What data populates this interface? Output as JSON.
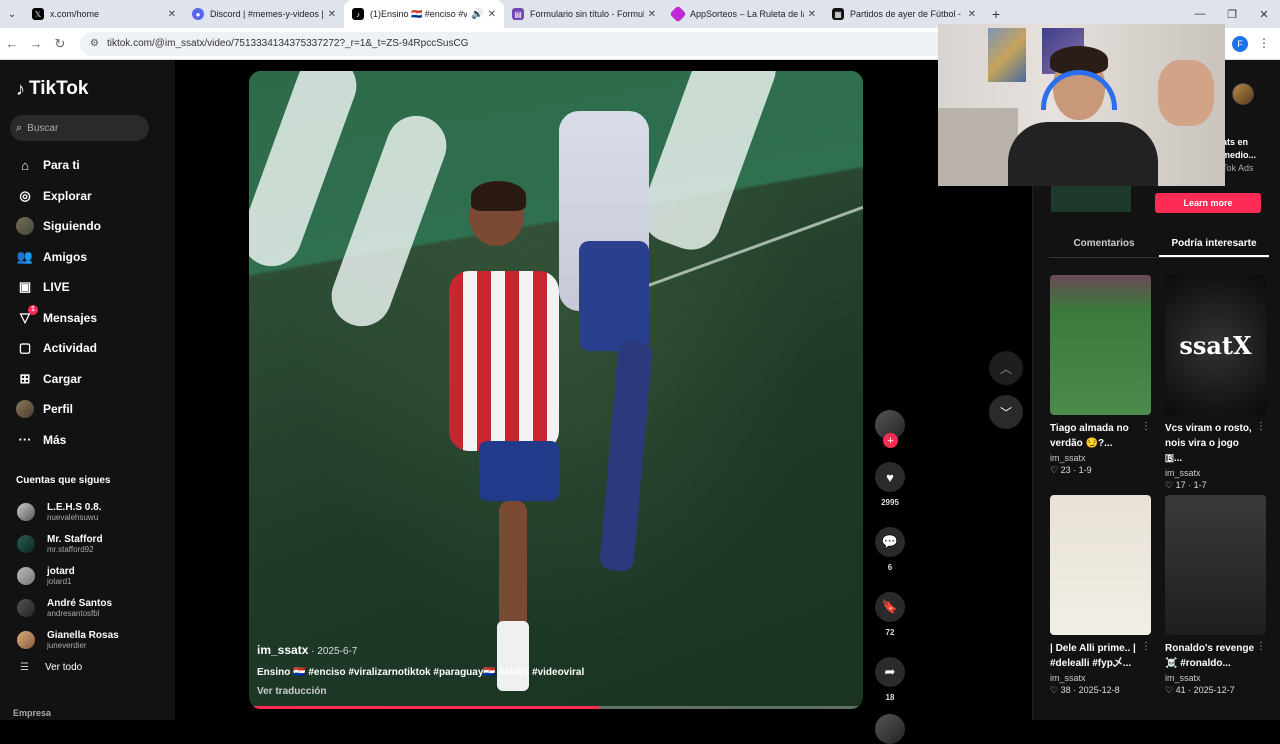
{
  "browser": {
    "tabs": [
      {
        "title": "x.com/home",
        "icon": "x-icon",
        "color": "#000000"
      },
      {
        "title": "Discord | #memes-y-videos | El",
        "icon": "discord-icon",
        "color": "#5865f2"
      },
      {
        "title": "(1)Ensino 🇵🇾 #enciso #vi",
        "icon": "tiktok-icon",
        "color": "#000000"
      },
      {
        "title": "Formulario sin título - Formular",
        "icon": "forms-icon",
        "color": "#7248b9"
      },
      {
        "title": "AppSorteos – La Ruleta de la S",
        "icon": "appsorteos-icon",
        "color": "#c026d3"
      },
      {
        "title": "Partidos de ayer de Fútbol - 36",
        "icon": "partidos-icon",
        "color": "#111111"
      }
    ],
    "url": "tiktok.com/@im_ssatx/video/7513334134375337272?_r=1&_t=ZS-94RpccSusCG",
    "profile_initial": "F"
  },
  "sidebar": {
    "logo": "TikTok",
    "search_placeholder": "Buscar",
    "nav": [
      {
        "label": "Para ti",
        "icon": "home-icon"
      },
      {
        "label": "Explorar",
        "icon": "compass-icon"
      },
      {
        "label": "Siguiendo",
        "icon": "following-avatar-icon"
      },
      {
        "label": "Amigos",
        "icon": "friends-icon"
      },
      {
        "label": "LIVE",
        "icon": "live-icon"
      },
      {
        "label": "Mensajes",
        "icon": "messages-icon",
        "badge": "1"
      },
      {
        "label": "Actividad",
        "icon": "activity-icon"
      },
      {
        "label": "Cargar",
        "icon": "upload-icon"
      },
      {
        "label": "Perfil",
        "icon": "profile-avatar-icon"
      },
      {
        "label": "Más",
        "icon": "more-icon"
      }
    ],
    "following_header": "Cuentas que sigues",
    "following": [
      {
        "name": "L.E.H.S 0.8.",
        "user": "nuevalehsuwu"
      },
      {
        "name": "Mr. Stafford",
        "user": "mr.stafford92"
      },
      {
        "name": "jotard",
        "user": "jotard1"
      },
      {
        "name": "André Santos",
        "user": "andresantosfbl"
      },
      {
        "name": "Gianella Rosas",
        "user": "juneverdier"
      }
    ],
    "see_all": "Ver todo",
    "footer": "Empresa"
  },
  "video": {
    "author": "im_ssatx",
    "date": "2025-6-7",
    "caption": "Ensino 🇵🇾 #enciso #viralizarnotiktok #paraguay🇵🇾 #skills #videoviral",
    "translate": "Ver traducción",
    "progress": 0.57
  },
  "actions": {
    "likes": "2995",
    "comments": "6",
    "saves": "72",
    "shares": "18"
  },
  "right_panel": {
    "ad_text": [
      "ats en",
      "medio...",
      "Tok Ads"
    ],
    "learn_more": "Learn more",
    "tabs": [
      "Comentarios",
      "Podría interesarte"
    ],
    "cards": [
      {
        "title": "Tiago almada no verdão 😏?...",
        "user": "im_ssatx",
        "stats": "♡ 23 · 1-9"
      },
      {
        "title": "Vcs viram o rosto, nois vira o jogo 🇧...",
        "user": "im_ssatx",
        "stats": "♡ 17 · 1-7"
      },
      {
        "title": "| Dele Alli prime.. | #delealli #fyp乄...",
        "user": "im_ssatx",
        "stats": "♡ 38 · 2025-12-8"
      },
      {
        "title": "Ronaldo's revenge ☠️ #ronaldo...",
        "user": "im_ssatx",
        "stats": "♡ 41 · 2025-12-7"
      }
    ],
    "card2_overlay": "ssatX"
  }
}
